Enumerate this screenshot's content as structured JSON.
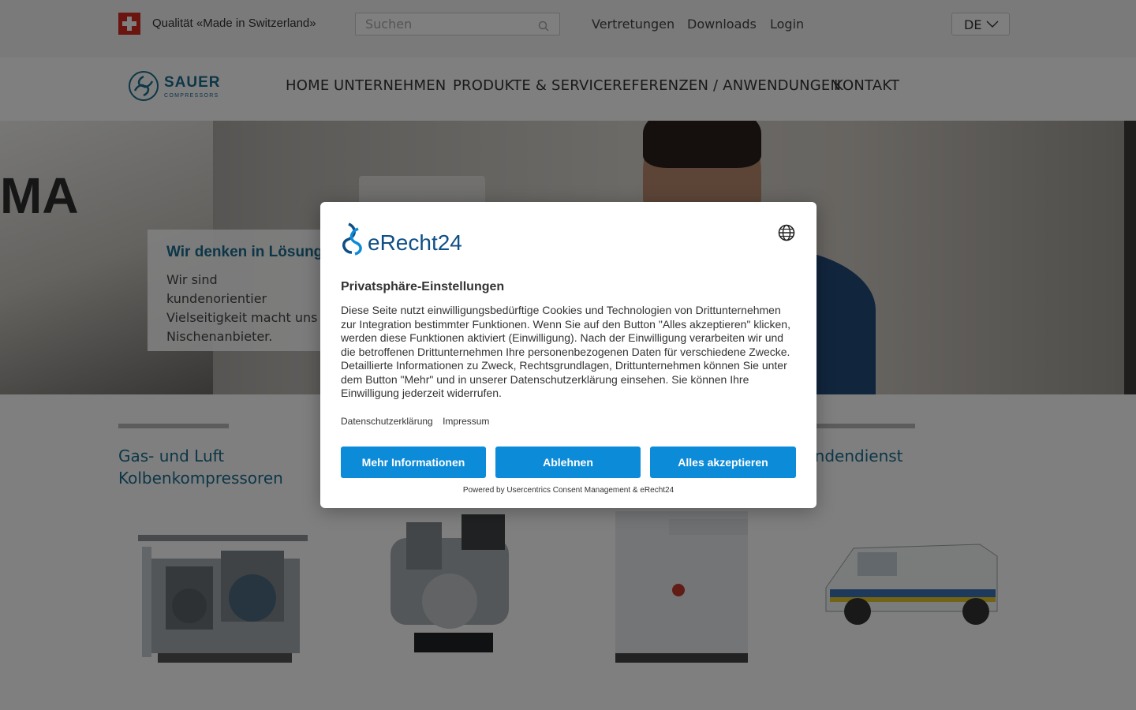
{
  "topbar": {
    "tagline": "Qualität «Made in Switzerland»",
    "search_placeholder": "Suchen",
    "links": [
      "Vertretungen",
      "Downloads",
      "Login"
    ],
    "language": "DE"
  },
  "logo": {
    "name": "SAUER",
    "sub": "COMPRESSORS"
  },
  "nav": {
    "items": [
      "HOME",
      "UNTERNEHMEN",
      "PRODUKTE & SERVICE",
      "REFERENZEN / ANWENDUNGEN",
      "KONTAKT"
    ]
  },
  "hero": {
    "bg_letters": "MA",
    "card_title": "Wir denken in Lösung",
    "card_text": "Wir sind kundenorientier Vielseitigkeit macht uns Nischenanbieter."
  },
  "categories": [
    {
      "title": "Gas- und Luft Kolbenkompressoren"
    },
    {
      "title": ""
    },
    {
      "title": ""
    },
    {
      "title": "undendienst"
    }
  ],
  "modal": {
    "brand": "eRecht24",
    "heading": "Privatsphäre-Einstellungen",
    "body": "Diese Seite nutzt einwilligungsbedürftige Cookies und Technologien von Drittunternehmen zur Integration bestimmter Funktionen. Wenn Sie auf den Button \"Alles akzeptieren\" klicken, werden diese Funktionen aktiviert (Einwilligung). Nach der Einwilligung verarbeiten wir und die betroffenen Drittunternehmen Ihre personenbezogenen Daten für verschiedene Zwecke. Detaillierte Informationen zu Zweck, Rechtsgrundlagen, Drittunternehmen können Sie unter dem Button \"Mehr\" und in unserer Datenschutzerklärung einsehen. Sie können Ihre Einwilligung jederzeit widerrufen.",
    "link_privacy": "Datenschutzerklärung",
    "link_imprint": "Impressum",
    "btn_more": "Mehr Informationen",
    "btn_decline": "Ablehnen",
    "btn_accept": "Alles akzeptieren",
    "powered_by": "Powered by Usercentrics Consent Management & eRecht24"
  },
  "colors": {
    "brand_blue": "#1a6d8f",
    "button_blue": "#0c8bd8",
    "erecht_blue": "#0e4f86"
  }
}
